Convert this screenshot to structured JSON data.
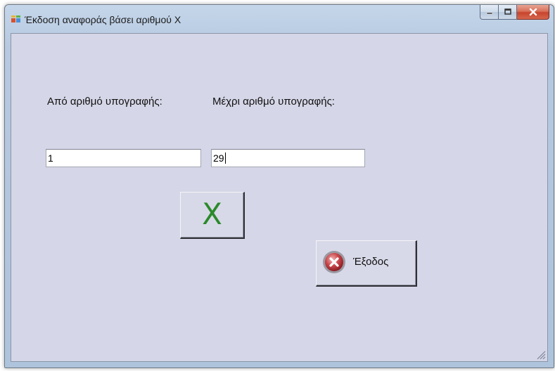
{
  "window": {
    "title": "Έκδοση αναφοράς βάσει αριθμού Χ"
  },
  "caption_buttons": {
    "minimize_icon": "minimize-icon",
    "maximize_icon": "maximize-icon",
    "close_icon": "close-icon"
  },
  "form": {
    "from_label": "Από αριθμό υπογραφής:",
    "to_label": "Μέχρι  αριθμό υπογραφής:",
    "from_value": "1",
    "to_value": "29"
  },
  "buttons": {
    "x_label": "X",
    "exit_label": "Έξοδος",
    "exit_icon": "exit-x-circle-icon"
  },
  "colors": {
    "client_bg": "#d5d6e7",
    "x_color": "#2a8a2a",
    "close_button": "#c7442b"
  }
}
